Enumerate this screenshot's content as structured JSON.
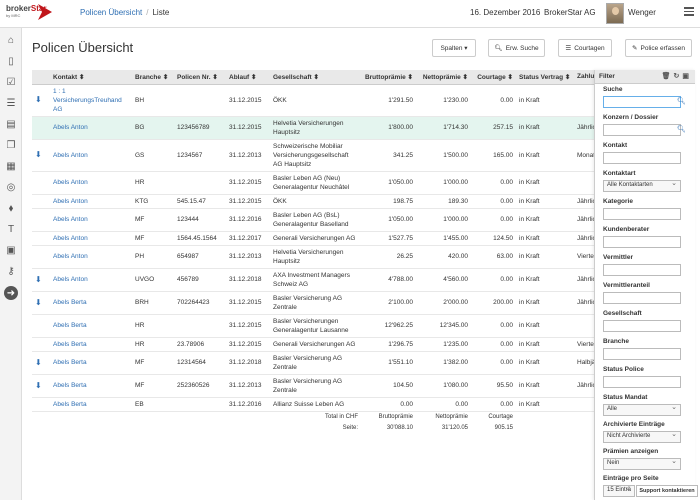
{
  "header": {
    "logo_text_a": "broker",
    "logo_text_b": "Star",
    "logo_sub": "by MRC",
    "breadcrumb_link": "Policen Übersicht",
    "breadcrumb_current": "Liste",
    "date": "16. Dezember 2016",
    "company": "BrokerStar AG",
    "user": "Wenger"
  },
  "page": {
    "title": "Policen Übersicht"
  },
  "toolbar": {
    "spalten": "Spalten ▾",
    "erw_suche": "Erw. Suche",
    "courtagen": "Courtagen",
    "police_erfassen": "Police erfassen"
  },
  "table": {
    "headers": [
      "Kontakt ⬍",
      "Branche ⬍",
      "Policen Nr. ⬍",
      "Ablauf ⬍",
      "Gesellschaft ⬍",
      "Bruttoprämie ⬍",
      "Nettoprämie ⬍",
      "Courtage ⬍",
      "Status Vertrag ⬍",
      "Zahlung"
    ],
    "rows": [
      [
        "1 : 1 VersicherungsTreuhand AG",
        "BH",
        "",
        "31.12.2015",
        "ÖKK",
        "1'291.50",
        "1'230.00",
        "0.00",
        "in Kraft",
        ""
      ],
      [
        "Abels Anton",
        "BG",
        "123456789",
        "31.12.2015",
        "Helvetia Versicherungen Hauptsitz",
        "1'800.00",
        "1'714.30",
        "257.15",
        "in Kraft",
        "Jährlich"
      ],
      [
        "Abels Anton",
        "GS",
        "1234567",
        "31.12.2013",
        "Schweizerische Mobiliar Versicherungsgesellschaft AG Hauptsitz",
        "341.25",
        "1'500.00",
        "165.00",
        "in Kraft",
        "Monatl"
      ],
      [
        "Abels Anton",
        "HR",
        "",
        "31.12.2015",
        "Basler Leben AG (Neu) Generalagentur Neuchâtel",
        "1'050.00",
        "1'000.00",
        "0.00",
        "in Kraft",
        ""
      ],
      [
        "Abels Anton",
        "KTG",
        "545.15.47",
        "31.12.2015",
        "ÖKK",
        "198.75",
        "189.30",
        "0.00",
        "in Kraft",
        "Jährlich"
      ],
      [
        "Abels Anton",
        "MF",
        "123444",
        "31.12.2016",
        "Basler Leben AG (BsL) Generalagentur Baselland",
        "1'050.00",
        "1'000.00",
        "0.00",
        "in Kraft",
        "Jährlich"
      ],
      [
        "Abels Anton",
        "MF",
        "1564.45.1564",
        "31.12.2017",
        "Generali Versicherungen AG",
        "1'527.75",
        "1'455.00",
        "124.50",
        "in Kraft",
        "Jährlich"
      ],
      [
        "Abels Anton",
        "PH",
        "654987",
        "31.12.2013",
        "Helvetia Versicherungen Hauptsitz",
        "26.25",
        "420.00",
        "63.00",
        "in Kraft",
        "Viertel"
      ],
      [
        "Abels Anton",
        "UVGO",
        "456789",
        "31.12.2018",
        "AXA Investment Managers Schweiz AG",
        "4'788.00",
        "4'560.00",
        "0.00",
        "in Kraft",
        "Jährlich"
      ],
      [
        "Abels Berta",
        "BRH",
        "702264423",
        "31.12.2015",
        "Basler Versicherung AG Zentrale",
        "2'100.00",
        "2'000.00",
        "200.00",
        "in Kraft",
        "Jährlich"
      ],
      [
        "Abels Berta",
        "HR",
        "",
        "31.12.2015",
        "Basler Versicherungen Generalagentur Lausanne",
        "12'962.25",
        "12'345.00",
        "0.00",
        "in Kraft",
        ""
      ],
      [
        "Abels Berta",
        "HR",
        "23.78906",
        "31.12.2015",
        "Generali Versicherungen AG",
        "1'296.75",
        "1'235.00",
        "0.00",
        "in Kraft",
        "Viertel"
      ],
      [
        "Abels Berta",
        "MF",
        "12314564",
        "31.12.2018",
        "Basler Versicherung AG Zentrale",
        "1'551.10",
        "1'382.00",
        "0.00",
        "in Kraft",
        "Halbjäh"
      ],
      [
        "Abels Berta",
        "MF",
        "252360526",
        "31.12.2013",
        "Basler Versicherung AG Zentrale",
        "104.50",
        "1'080.00",
        "95.50",
        "in Kraft",
        "Jährlich"
      ],
      [
        "Abels Berta",
        "EB",
        "",
        "31.12.2016",
        "Allianz Suisse Leben AG",
        "0.00",
        "0.00",
        "0.00",
        "in Kraft",
        ""
      ]
    ],
    "download_rows": [
      0,
      2,
      8,
      9,
      12,
      13
    ],
    "highlight_row": 1,
    "totals": {
      "label_a": "Total in CHF",
      "label_b": "Seite:",
      "brutto_label": "Bruttoprämie",
      "brutto_value": "30'088.10",
      "netto_label": "Nettoprämie",
      "netto_value": "31'120.05",
      "courtage_label": "Courtage",
      "courtage_value": "905.15"
    }
  },
  "filter": {
    "title": "Filter",
    "suche": "Suche",
    "konzern": "Konzern / Dossier",
    "kontakt": "Kontakt",
    "kontaktart": "Kontaktart",
    "kontaktart_value": "Alle Kontaktarten",
    "kategorie": "Kategorie",
    "kundenberater": "Kundenberater",
    "vermittler": "Vermittler",
    "vermittleranteil": "Vermittleranteil",
    "gesellschaft": "Gesellschaft",
    "branche": "Branche",
    "status_police": "Status Police",
    "status_mandat": "Status Mandat",
    "status_mandat_value": "Alle",
    "archivierte": "Archivierte Einträge",
    "archivierte_value": "Nicht Archivierte",
    "praemien": "Prämien anzeigen",
    "praemien_value": "Nein",
    "eintraege": "Einträge pro Seite",
    "eintraege_value": "15 Einträ"
  },
  "support": "Support kontaktieren"
}
